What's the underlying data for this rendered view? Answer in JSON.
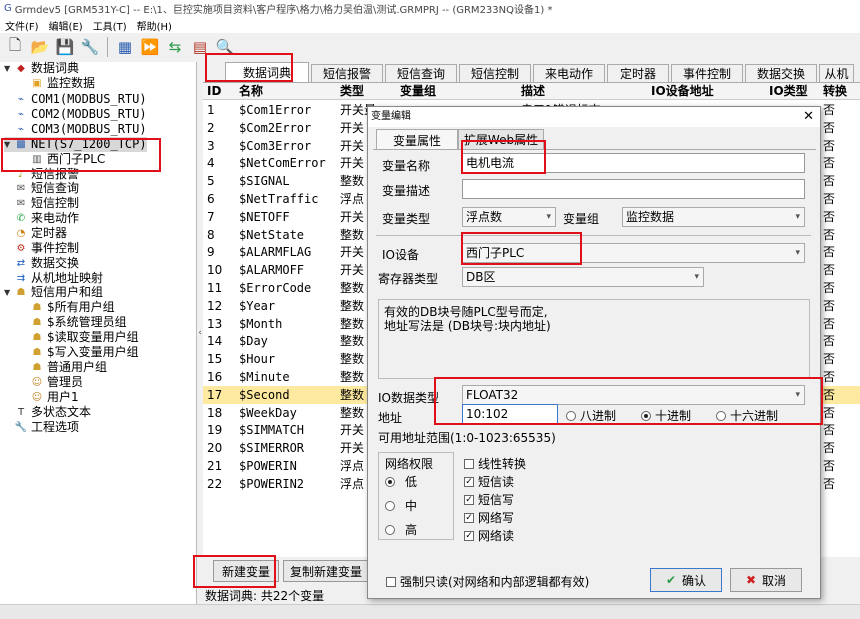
{
  "window": {
    "title": "Grmdev5 [GRM531Y-C] -- E:\\1、巨控实施项目资料\\客户程序\\格力\\格力吴伯温\\测试.GRMPRJ -- (GRM233NQ设备1) *"
  },
  "menu": [
    "文件(F)",
    "编辑(E)",
    "工具(T)",
    "帮助(H)"
  ],
  "tree": {
    "items": [
      {
        "label": "数据词典",
        "level": 0,
        "exp": "▼",
        "icon": "book-icon"
      },
      {
        "label": "监控数据",
        "level": 1,
        "exp": "",
        "icon": "folder-icon"
      },
      {
        "label": "COM1(MODBUS_RTU)",
        "level": 0,
        "exp": "",
        "icon": "plug-icon"
      },
      {
        "label": "COM2(MODBUS_RTU)",
        "level": 0,
        "exp": "",
        "icon": "plug-icon"
      },
      {
        "label": "COM3(MODBUS_RTU)",
        "level": 0,
        "exp": "",
        "icon": "plug-icon"
      },
      {
        "label": "NET(S7_1200_TCP)",
        "level": 0,
        "exp": "▼",
        "icon": "network-icon"
      },
      {
        "label": "西门子PLC",
        "level": 1,
        "exp": "",
        "icon": "device-icon"
      },
      {
        "label": "短信报警",
        "level": 0,
        "exp": "",
        "icon": "bell-icon"
      },
      {
        "label": "短信查询",
        "level": 0,
        "exp": "",
        "icon": "message-icon"
      },
      {
        "label": "短信控制",
        "level": 0,
        "exp": "",
        "icon": "message-icon"
      },
      {
        "label": "来电动作",
        "level": 0,
        "exp": "",
        "icon": "phone-icon"
      },
      {
        "label": "定时器",
        "level": 0,
        "exp": "",
        "icon": "clock-icon"
      },
      {
        "label": "事件控制",
        "level": 0,
        "exp": "",
        "icon": "event-icon"
      },
      {
        "label": "数据交换",
        "level": 0,
        "exp": "",
        "icon": "exchange-icon"
      },
      {
        "label": "从机地址映射",
        "level": 0,
        "exp": "",
        "icon": "map-icon"
      },
      {
        "label": "短信用户和组",
        "level": 0,
        "exp": "▼",
        "icon": "users-icon"
      },
      {
        "label": "$所有用户组",
        "level": 1,
        "exp": "",
        "icon": "group-icon"
      },
      {
        "label": "$系统管理员组",
        "level": 1,
        "exp": "",
        "icon": "group-icon"
      },
      {
        "label": "$读取变量用户组",
        "level": 1,
        "exp": "",
        "icon": "group-icon"
      },
      {
        "label": "$写入变量用户组",
        "level": 1,
        "exp": "",
        "icon": "group-icon"
      },
      {
        "label": "普通用户组",
        "level": 1,
        "exp": "",
        "icon": "group-icon"
      },
      {
        "label": "管理员",
        "level": 1,
        "exp": "",
        "icon": "user-icon"
      },
      {
        "label": "用户1",
        "level": 1,
        "exp": "",
        "icon": "user-icon"
      },
      {
        "label": "多状态文本",
        "level": 0,
        "exp": "",
        "icon": "text-icon"
      },
      {
        "label": "工程选项",
        "level": 0,
        "exp": "",
        "icon": "wrench-icon"
      }
    ]
  },
  "tabs": [
    "数据词典",
    "短信报警",
    "短信查询",
    "短信控制",
    "来电动作",
    "定时器",
    "事件控制",
    "数据交换",
    "从机"
  ],
  "grid": {
    "headers": [
      "ID",
      "名称",
      "类型",
      "变量组",
      "描述",
      "IO设备地址",
      "IO类型",
      "转换"
    ],
    "rows": [
      {
        "id": "1",
        "name": "$Com1Error",
        "type": "开关量",
        "conv": "否"
      },
      {
        "id": "2",
        "name": "$Com2Error",
        "type": "开关",
        "conv": "否"
      },
      {
        "id": "3",
        "name": "$Com3Error",
        "type": "开关",
        "conv": "否"
      },
      {
        "id": "4",
        "name": "$NetComError",
        "type": "开关",
        "conv": "否"
      },
      {
        "id": "5",
        "name": "$SIGNAL",
        "type": "整数",
        "conv": "否"
      },
      {
        "id": "6",
        "name": "$NetTraffic",
        "type": "浮点",
        "conv": "否"
      },
      {
        "id": "7",
        "name": "$NETOFF",
        "type": "开关",
        "conv": "否"
      },
      {
        "id": "8",
        "name": "$NetState",
        "type": "整数",
        "conv": "否"
      },
      {
        "id": "9",
        "name": "$ALARMFLAG",
        "type": "开关",
        "conv": "否"
      },
      {
        "id": "10",
        "name": "$ALARMOFF",
        "type": "开关",
        "conv": "否"
      },
      {
        "id": "11",
        "name": "$ErrorCode",
        "type": "整数",
        "conv": "否"
      },
      {
        "id": "12",
        "name": "$Year",
        "type": "整数",
        "conv": "否"
      },
      {
        "id": "13",
        "name": "$Month",
        "type": "整数",
        "conv": "否"
      },
      {
        "id": "14",
        "name": "$Day",
        "type": "整数",
        "conv": "否"
      },
      {
        "id": "15",
        "name": "$Hour",
        "type": "整数",
        "conv": "否"
      },
      {
        "id": "16",
        "name": "$Minute",
        "type": "整数",
        "conv": "否"
      },
      {
        "id": "17",
        "name": "$Second",
        "type": "整数",
        "conv": "否"
      },
      {
        "id": "18",
        "name": "$WeekDay",
        "type": "整数",
        "conv": "否"
      },
      {
        "id": "19",
        "name": "$SIMMATCH",
        "type": "开关",
        "conv": "否"
      },
      {
        "id": "20",
        "name": "$SIMERROR",
        "type": "开关",
        "conv": "否"
      },
      {
        "id": "21",
        "name": "$POWERIN",
        "type": "浮点",
        "conv": "否"
      },
      {
        "id": "22",
        "name": "$POWERIN2",
        "type": "浮点",
        "conv": "否"
      }
    ],
    "row1_desc": "串口1错误标志",
    "selected_row": "17"
  },
  "buttons": {
    "new_var": "新建变量",
    "copy_new": "复制新建变量"
  },
  "status": "数据词典: 共22个变量",
  "dialog": {
    "title": "变量编辑",
    "tabs": [
      "变量属性",
      "扩展Web属性"
    ],
    "var_name_label": "变量名称",
    "var_name": "电机电流",
    "var_desc_label": "变量描述",
    "var_desc": "",
    "var_type_label": "变量类型",
    "var_type": "浮点数",
    "var_group_label": "变量组",
    "var_group": "监控数据",
    "io_device_label": "IO设备",
    "io_device": "西门子PLC",
    "reg_type_label": "寄存器类型",
    "reg_type": "DB区",
    "note": "有效的DB块号随PLC型号而定,\n地址写法是 (DB块号:块内地址)",
    "io_dtype_label": "IO数据类型",
    "io_dtype": "FLOAT32",
    "addr_label": "地址",
    "addr": "10:102",
    "radix": {
      "oct": "八进制",
      "dec": "十进制",
      "hex": "十六进制",
      "selected": "dec"
    },
    "range": "可用地址范围(1:0-1023:65535)",
    "perm_title": "网络权限",
    "perm": {
      "low": "低",
      "mid": "中",
      "high": "高",
      "selected": "low"
    },
    "checks": [
      {
        "label": "线性转换",
        "checked": false
      },
      {
        "label": "短信读",
        "checked": true
      },
      {
        "label": "短信写",
        "checked": true
      },
      {
        "label": "网络写",
        "checked": true
      },
      {
        "label": "网络读",
        "checked": true
      }
    ],
    "readonly": "强制只读(对网络和内部逻辑都有效)",
    "ok": "确认",
    "cancel": "取消"
  }
}
